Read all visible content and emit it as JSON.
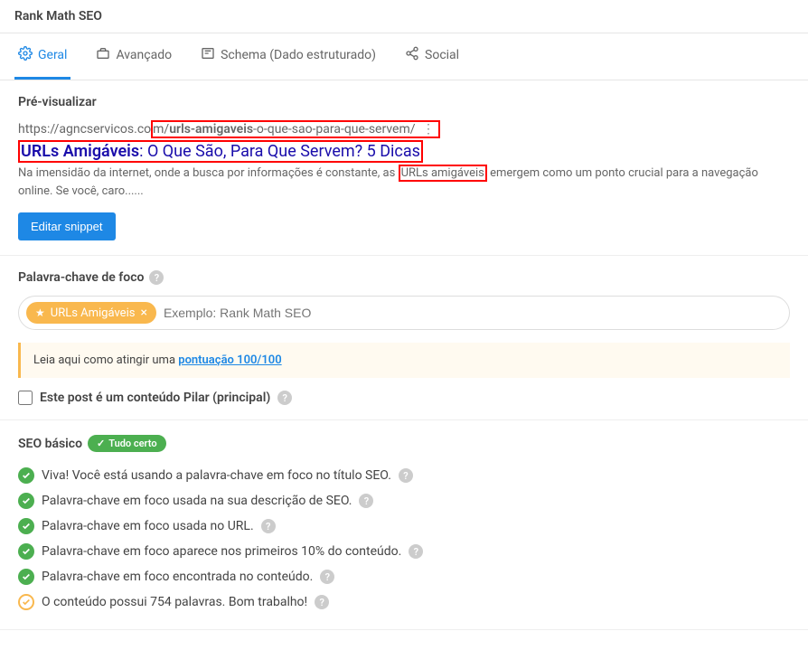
{
  "header": {
    "title": "Rank Math SEO"
  },
  "tabs": [
    {
      "label": "Geral",
      "active": true
    },
    {
      "label": "Avançado",
      "active": false
    },
    {
      "label": "Schema (Dado estruturado)",
      "active": false
    },
    {
      "label": "Social",
      "active": false
    }
  ],
  "preview": {
    "section_title": "Pré-visualizar",
    "url_prefix": "https://agncservicos.co",
    "url_boxed_pre": "m/",
    "url_slug_bold": "urls-amigaveis",
    "url_slug_rest": "-o-que-sao-para-que-servem/",
    "title_hl": "URLs Amigáveis",
    "title_rest": ": O Que São, Para Que Servem? 5 Dicas",
    "desc_pre": "Na imensidão da internet, onde a busca por informações é constante, as ",
    "desc_hl": "URLs amigáveis",
    "desc_post": " emergem como um ponto crucial para a navegação online. Se você, caro......",
    "edit_button": "Editar snippet"
  },
  "focus_keyword": {
    "section_title": "Palavra-chave de foco",
    "chip": "URLs Amigáveis",
    "placeholder": "Exemplo: Rank Math SEO",
    "notice_pre": "Leia aqui como atingir uma ",
    "notice_link": "pontuação 100/100",
    "pillar_label": "Este post é um conteúdo Pilar (principal)"
  },
  "seo_basic": {
    "section_title": "SEO básico",
    "badge": "Tudo certo",
    "checks": [
      {
        "status": "ok",
        "text": "Viva! Você está usando a palavra-chave em foco no título SEO."
      },
      {
        "status": "ok",
        "text": "Palavra-chave em foco usada na sua descrição de SEO."
      },
      {
        "status": "ok",
        "text": "Palavra-chave em foco usada no URL."
      },
      {
        "status": "ok",
        "text": "Palavra-chave em foco aparece nos primeiros 10% do conteúdo."
      },
      {
        "status": "ok",
        "text": "Palavra-chave em foco encontrada no conteúdo."
      },
      {
        "status": "warn",
        "text": "O conteúdo possui 754 palavras. Bom trabalho!"
      }
    ]
  }
}
